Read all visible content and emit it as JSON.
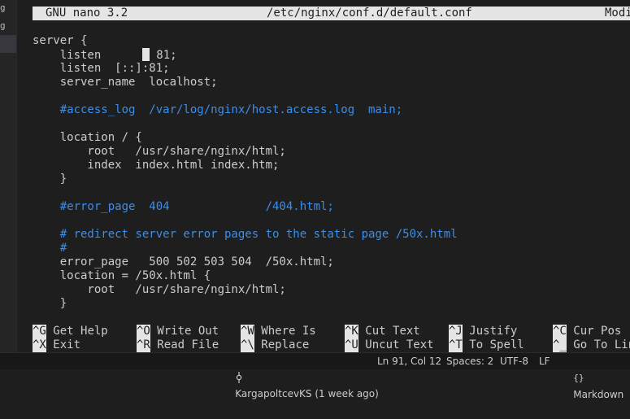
{
  "left_rail": {
    "glyphs": [
      "g",
      "g"
    ]
  },
  "nano": {
    "version": "GNU nano 3.2",
    "filename": "/etc/nginx/conf.d/default.conf",
    "state": "Modi"
  },
  "code": [
    "server {",
    "    listen      ",
    " 81;",
    "    listen  [::]:81;",
    "    server_name  localhost;",
    "",
    "    #access_log  /var/log/nginx/host.access.log  main;",
    "",
    "    location / {",
    "        root   /usr/share/nginx/html;",
    "        index  index.html index.htm;",
    "    }",
    "",
    "    #error_page  404              /404.html;",
    "",
    "    # redirect server error pages to the static page /50x.html",
    "    #",
    "    error_page   500 502 503 504  /50x.html;",
    "    location = /50x.html {",
    "        root   /usr/share/nginx/html;",
    "    }"
  ],
  "shortcuts": [
    {
      "key": "^G",
      "label": "Get Help"
    },
    {
      "key": "^O",
      "label": "Write Out"
    },
    {
      "key": "^W",
      "label": "Where Is"
    },
    {
      "key": "^K",
      "label": "Cut Text"
    },
    {
      "key": "^J",
      "label": "Justify"
    },
    {
      "key": "^C",
      "label": "Cur Pos"
    },
    {
      "key": "^X",
      "label": "Exit"
    },
    {
      "key": "^R",
      "label": "Read File"
    },
    {
      "key": "^\\",
      "label": "Replace"
    },
    {
      "key": "^U",
      "label": "Uncut Text"
    },
    {
      "key": "^T",
      "label": "To Spell"
    },
    {
      "key": "^_",
      "label": "Go To Lin"
    }
  ],
  "statusbar": {
    "git_icon": "git-commit-icon",
    "blame": "KargapoltcevKS (1 week ago)",
    "position": "Ln 91, Col 12",
    "indent": "Spaces: 2",
    "encoding": "UTF-8",
    "eol": "LF",
    "language_icon": "braces-icon",
    "language": "Markdown"
  },
  "colors": {
    "background": "#1e1e1e",
    "header_bg": "#e5e5e5",
    "comment": "#3b8eea",
    "statusbar_bg": "#181818"
  }
}
